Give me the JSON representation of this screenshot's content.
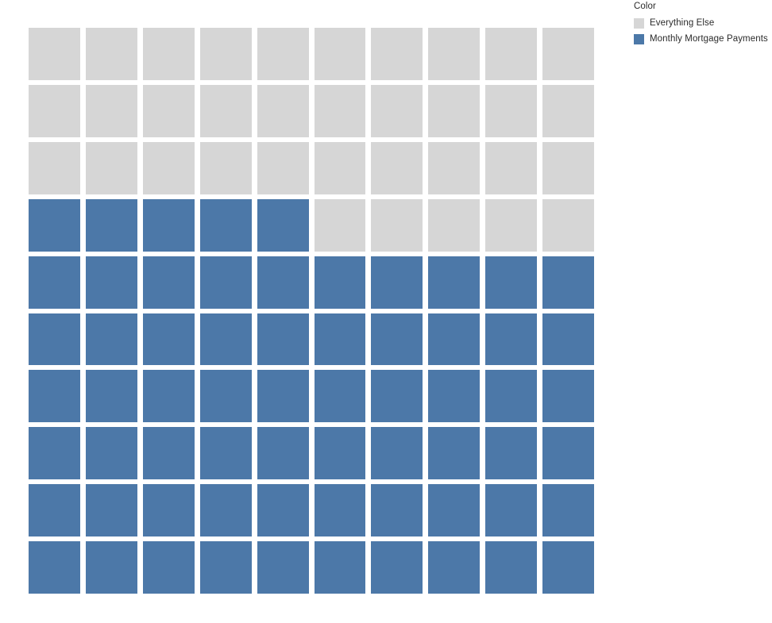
{
  "legend": {
    "title": "Color",
    "entries": [
      {
        "label": "Everything Else",
        "color": "#d6d6d6"
      },
      {
        "label": "Monthly Mortgage Payments",
        "color": "#4c78a8"
      }
    ]
  },
  "chart_data": {
    "type": "waffle",
    "title": "",
    "subtitle": "",
    "xlabel": "",
    "ylabel": "",
    "grid_rows": 10,
    "grid_cols": 10,
    "total_cells": 100,
    "fill_order": "bottom-up-left-to-right",
    "categories": [
      "Monthly Mortgage Payments",
      "Everything Else"
    ],
    "values": [
      65,
      35
    ],
    "units": "percent",
    "series": [
      {
        "name": "Monthly Mortgage Payments",
        "value": 65,
        "cells": 65,
        "color": "#4c78a8"
      },
      {
        "name": "Everything Else",
        "value": 35,
        "cells": 35,
        "color": "#d6d6d6"
      }
    ],
    "cell_matrix": [
      [
        0,
        0,
        0,
        0,
        0,
        0,
        0,
        0,
        0,
        0
      ],
      [
        0,
        0,
        0,
        0,
        0,
        0,
        0,
        0,
        0,
        0
      ],
      [
        0,
        0,
        0,
        0,
        0,
        0,
        0,
        0,
        0,
        0
      ],
      [
        1,
        1,
        1,
        1,
        1,
        0,
        0,
        0,
        0,
        0
      ],
      [
        1,
        1,
        1,
        1,
        1,
        1,
        1,
        1,
        1,
        1
      ],
      [
        1,
        1,
        1,
        1,
        1,
        1,
        1,
        1,
        1,
        1
      ],
      [
        1,
        1,
        1,
        1,
        1,
        1,
        1,
        1,
        1,
        1
      ],
      [
        1,
        1,
        1,
        1,
        1,
        1,
        1,
        1,
        1,
        1
      ],
      [
        1,
        1,
        1,
        1,
        1,
        1,
        1,
        1,
        1,
        1
      ],
      [
        1,
        1,
        1,
        1,
        1,
        1,
        1,
        1,
        1,
        1
      ]
    ],
    "legend_position": "top-right",
    "grid": false,
    "background": "#ffffff"
  }
}
